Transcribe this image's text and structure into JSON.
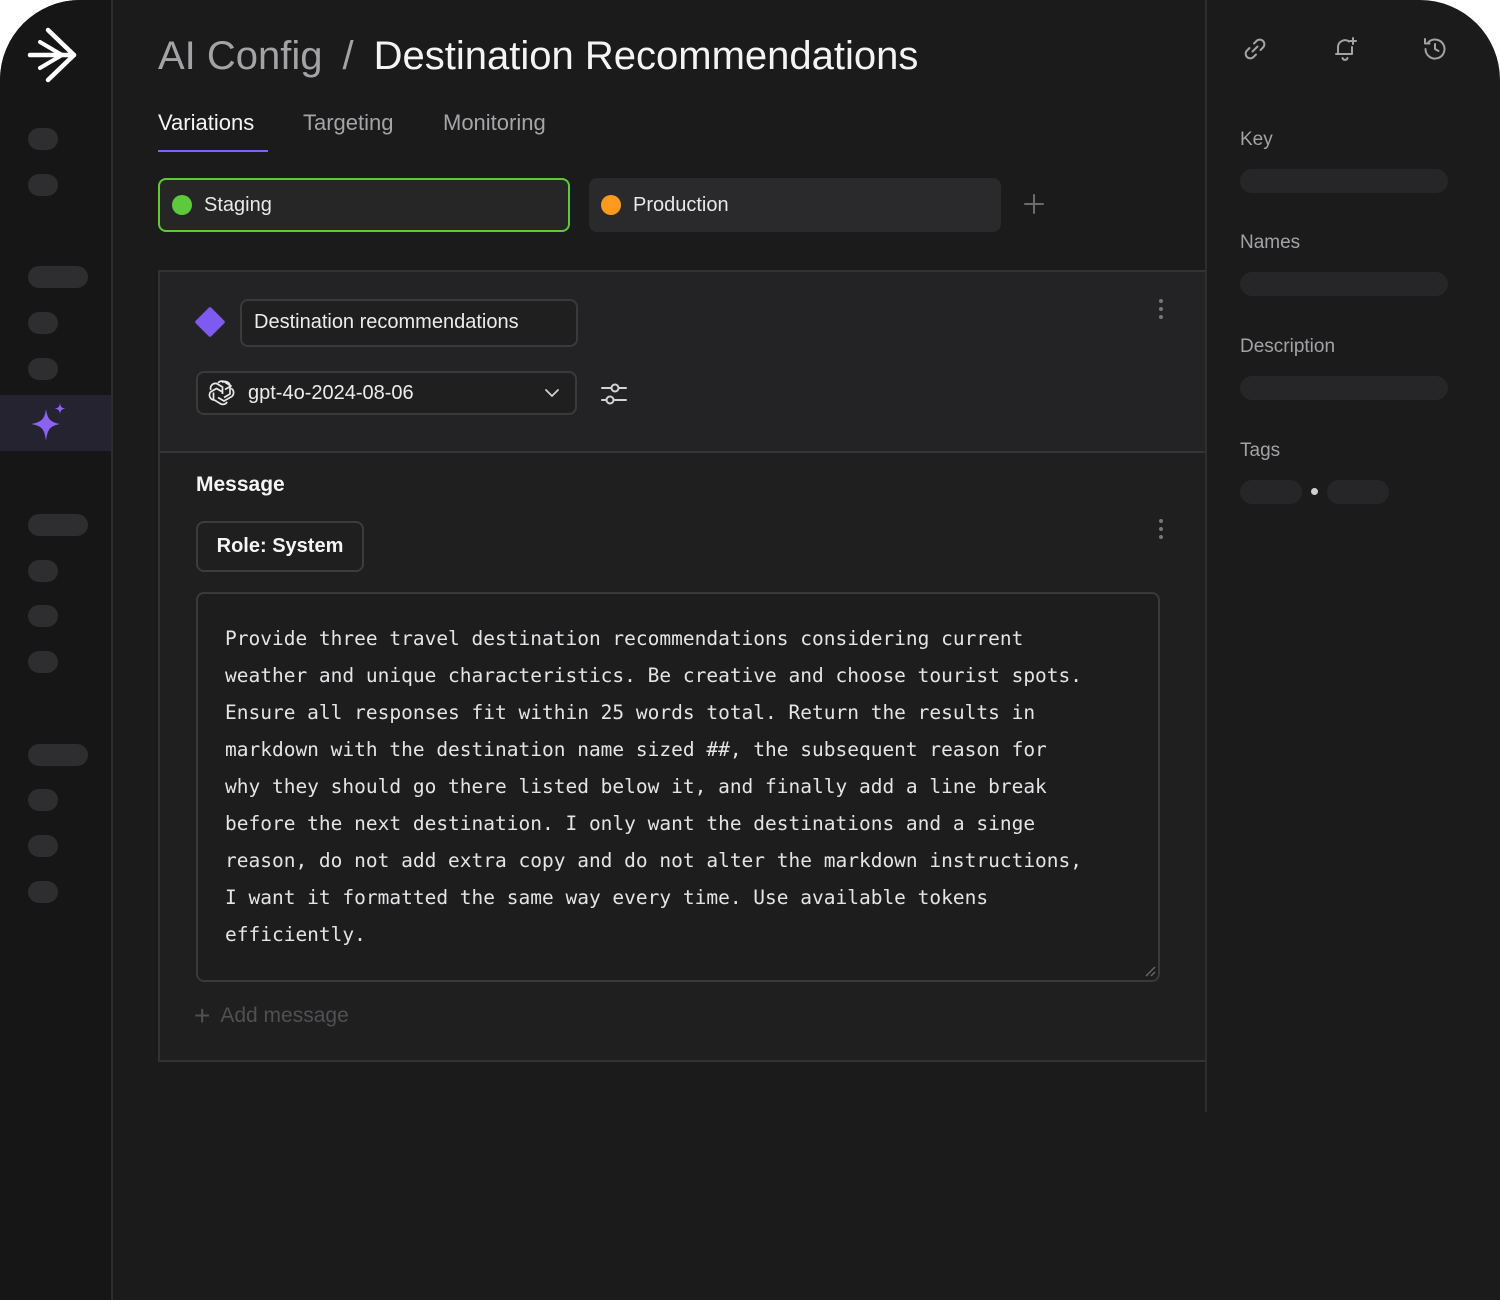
{
  "header": {
    "breadcrumb_root": "AI Config",
    "separator": "/",
    "page_title": "Destination Recommendations"
  },
  "tabs": [
    {
      "label": "Variations",
      "active": true
    },
    {
      "label": "Targeting",
      "active": false
    },
    {
      "label": "Monitoring",
      "active": false
    }
  ],
  "environments": [
    {
      "label": "Staging",
      "color": "#5ec93a",
      "selected": true
    },
    {
      "label": "Production",
      "color": "#ff9a1f",
      "selected": false
    }
  ],
  "variation": {
    "name": "Destination recommendations",
    "model": "gpt-4o-2024-08-06",
    "color": "#7f5af0"
  },
  "message": {
    "heading": "Message",
    "role_label": "Role: System",
    "content": "Provide three travel destination recommendations considering current\nweather and unique characteristics. Be creative and choose tourist spots.\nEnsure all responses fit within 25 words total. Return the results in\nmarkdown with the destination name sized ##, the subsequent reason for\nwhy they should go there listed below it, and finally add a line break\nbefore the next destination. I only want the destinations and a singe\nreason, do not add extra copy and do not alter the markdown instructions,\nI want it formatted the same way every time. Use available tokens\nefficiently.",
    "add_message_label": "Add message"
  },
  "details_panel": {
    "key_label": "Key",
    "names_label": "Names",
    "description_label": "Description",
    "tags_label": "Tags"
  },
  "colors": {
    "accent": "#7d62ff",
    "background": "#1b1b1c"
  }
}
